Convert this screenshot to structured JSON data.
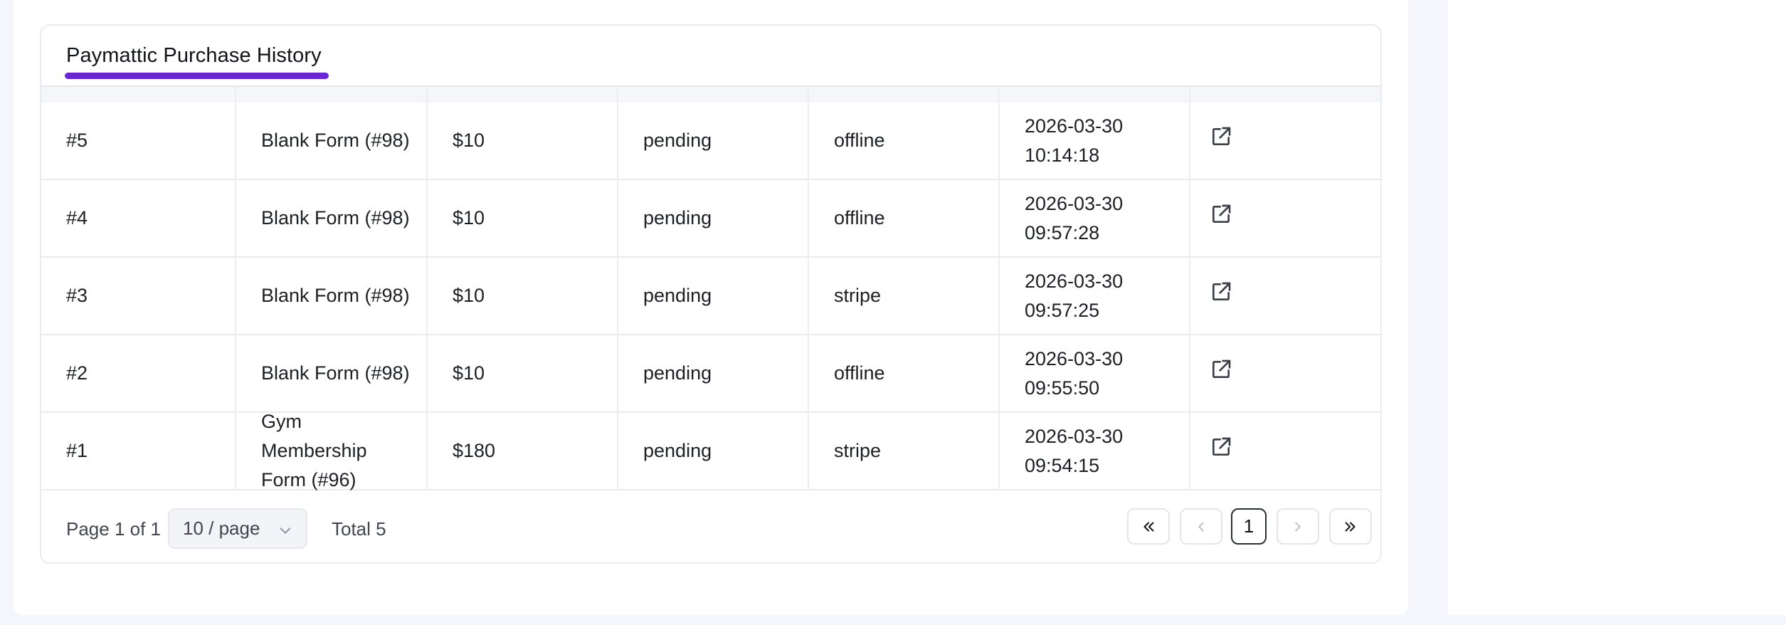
{
  "card": {
    "title": "Paymattic Purchase History"
  },
  "rows": [
    {
      "id": "#5",
      "form": "Blank Form (#98)",
      "amount": "$10",
      "status": "pending",
      "method": "offline",
      "date": "2026-03-30",
      "time": "10:14:18"
    },
    {
      "id": "#4",
      "form": "Blank Form (#98)",
      "amount": "$10",
      "status": "pending",
      "method": "offline",
      "date": "2026-03-30",
      "time": "09:57:28"
    },
    {
      "id": "#3",
      "form": "Blank Form (#98)",
      "amount": "$10",
      "status": "pending",
      "method": "stripe",
      "date": "2026-03-30",
      "time": "09:57:25"
    },
    {
      "id": "#2",
      "form": "Blank Form (#98)",
      "amount": "$10",
      "status": "pending",
      "method": "offline",
      "date": "2026-03-30",
      "time": "09:55:50"
    },
    {
      "id": "#1",
      "form": "Gym Membership Form (#96)",
      "amount": "$180",
      "status": "pending",
      "method": "stripe",
      "date": "2026-03-30",
      "time": "09:54:15"
    }
  ],
  "pagination": {
    "page_info": "Page 1 of 1",
    "page_size": "10 / page",
    "total": "Total 5",
    "current_page": "1"
  },
  "icons": {
    "row_action": "external-link-icon",
    "first": "double-chevron-left-icon",
    "prev": "chevron-left-icon",
    "next": "chevron-right-icon",
    "last": "double-chevron-right-icon",
    "select": "chevron-down-icon"
  },
  "colors": {
    "accent_underline": "#6a25d4"
  }
}
